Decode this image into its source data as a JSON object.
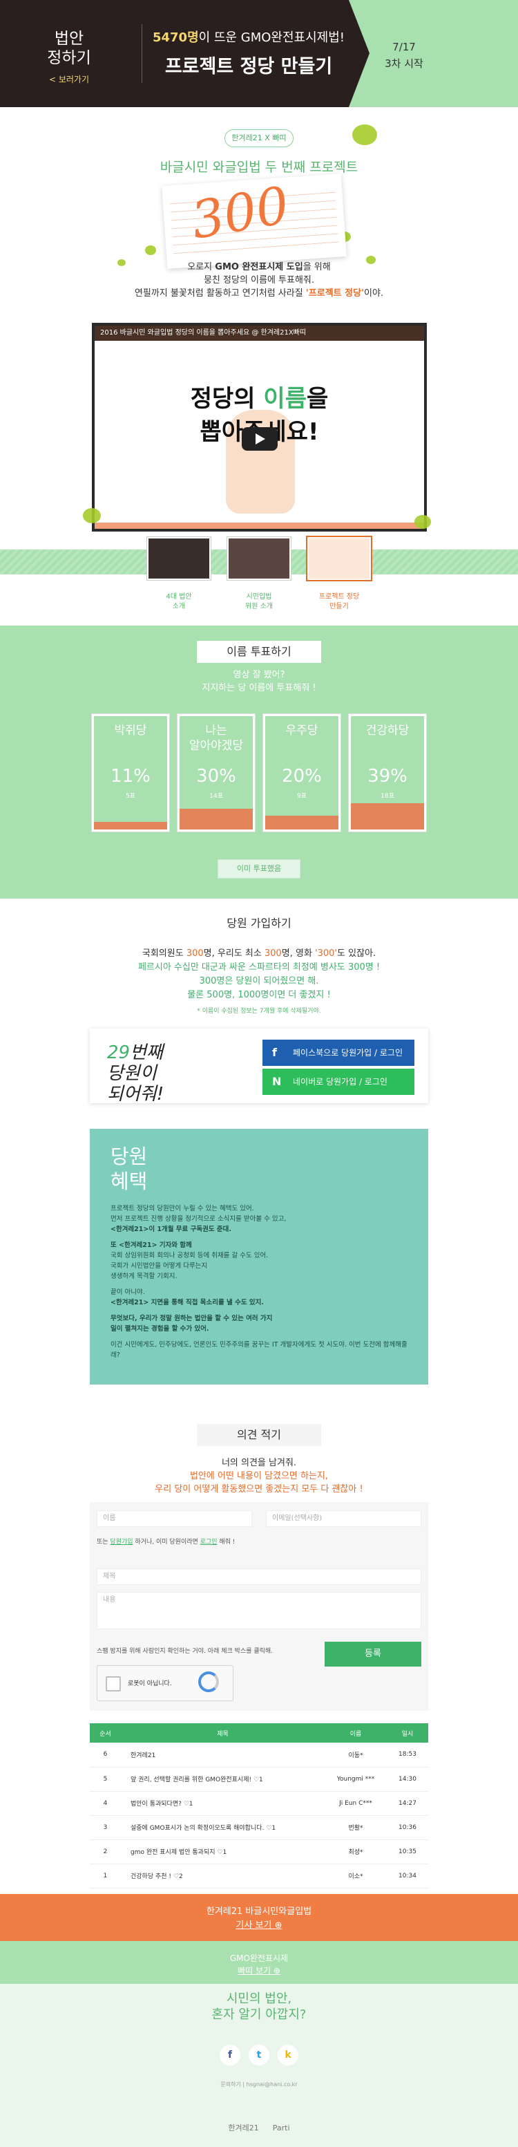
{
  "header": {
    "tab1": "법안",
    "tab2": "정하기",
    "back": "< 보러가기",
    "sub_pre": "5470명",
    "sub_post": "이 뜨운 GMO완전표시제법!",
    "title": "프로젝트 정당 만들기",
    "date": "7/17",
    "start": "3차 시작"
  },
  "hero": {
    "tag": "한겨레21 X 빠띠",
    "headline": "바글시민 와글입법 두 번째 프로젝트",
    "number": "300",
    "intro1_pre": "오로지 ",
    "intro1_hl": "GMO 완전표시제 도입",
    "intro1_post": "을 위해",
    "intro2": "뭉친 정당의 이름에 투표해줘.",
    "intro3_pre": "연필까지 불꽃처럼 활동하고 연기처럼 사라질 ",
    "intro3_hl": "'프로젝트 정당'",
    "intro3_post": "이야.",
    "video_title": "2016 바글시민 와글입법 정당의 이름을 뽑아주세요 @ 한겨레21X빠띠",
    "video_l1_pre": "정당의 ",
    "video_l1_hl": "이름",
    "video_l1_post": "을",
    "video_l2": "뽑아주세요!"
  },
  "thumbs": [
    {
      "label1": "4대 법안",
      "label2": "소개"
    },
    {
      "label1": "시민입법",
      "label2": "위원 소개"
    },
    {
      "label1": "프로젝트 정당",
      "label2": "만들기"
    }
  ],
  "vote": {
    "title": "이름 투표하기",
    "q1": "영상 잘 봤어?",
    "q2": "지지하는 당 이름에 투표해줘 !",
    "vote_button": "이미 투표했음",
    "cards": [
      {
        "name1": "박쥐당",
        "name2": "",
        "percent": "11%",
        "count": "5표",
        "ratio": 0.11
      },
      {
        "name1": "나는",
        "name2": "알아야겠당",
        "percent": "30%",
        "count": "14표",
        "ratio": 0.3
      },
      {
        "name1": "우주당",
        "name2": "",
        "percent": "20%",
        "count": "9표",
        "ratio": 0.2
      },
      {
        "name1": "건강하당",
        "name2": "",
        "percent": "39%",
        "count": "18표",
        "ratio": 0.39
      }
    ]
  },
  "join": {
    "title": "당원 가입하기",
    "d1_a": "국회의원도 ",
    "d1_b": "300",
    "d1_c": "명, 우리도 최소 ",
    "d1_d": "300",
    "d1_e": "명, 영화 ",
    "d1_f": "'300'",
    "d1_g": "도 있잖아.",
    "d2": "페르시아 수십만 대군과 싸운 스파르타의 최정예 병사도 300명 !",
    "d3": "300명은 당원이 되어줬으면 해.",
    "d4": "물론 500명, 1000명이면 더 좋겠지 !",
    "note": "* 이름이 수집된 정보는 7개월 후에 삭제될거야.",
    "num": "29",
    "box_t1": "번째",
    "box_t2": "당원이",
    "box_t3": "되어줘!",
    "fb_icon": "f",
    "fb": "페이스북으로 당원가입 / 로그인",
    "nv_icon": "N",
    "nv": "네이버로 당원가입 / 로그인",
    "ben_t1": "당원",
    "ben_t2": "혜택",
    "ben_lines": [
      "프로젝트 정당의 당원만이 누릴 수 있는 혜택도 있어.",
      "먼저 프로젝트 진행 상황을 정기적으로 소식지를 받아볼 수 있고,",
      "<한겨레21>이 1개월 무료 구독권도 준대.",
      "",
      "또 <한겨레21> 기자와 함께",
      "국회 상임위원회 회의나 공청회 등에 취재를 갈 수도 있어.",
      "국회가 시민법안을 어떻게 다루는지",
      "생생하게 목격할 기회지.",
      "",
      "끝이 아니야.",
      "<한겨레21> 지면을 통해 직접 목소리를 낼 수도 있지.",
      "",
      "무엇보다, 우리가 정말 원하는 법안을 할 수 있는 여러 가지",
      "일이 펼쳐지는 경험을 할 수가 있어.",
      "",
      "이건 시민에게도, 민주당에도, 언론인도 민주주의를 꿈꾸는 IT 개발자에게도 첫 시도야. 이번 도전에 함께해줄래?"
    ]
  },
  "comment": {
    "title": "의견 적기",
    "i1": "너의 의견을 남겨줘.",
    "i2": "법안에 어떤 내용이 담겼으면 하는지,",
    "i3": "우리 당이 어떻게 활동했으면 좋겠는지 모두 다 괜찮아 !",
    "name_ph": "이름",
    "email_ph": "이메일(선택사항)",
    "login_pre": "또는 ",
    "login_a": "당원가입",
    "login_mid": " 하거나, 이미 당원이라면 ",
    "login_b": "로그인",
    "login_post": " 해줘 !",
    "subject_ph": "제목",
    "body_ph": "내용",
    "spam": "스팸 방지를 위해 사람인지 확인하는 거야. 아래 체크 박스를 클릭해.",
    "captcha": "로봇이 아닙니다.",
    "submit": "등록",
    "cols": [
      "순서",
      "제목",
      "이름",
      "일시"
    ],
    "rows": [
      [
        "6",
        "한겨레21",
        "이동*",
        "18:53"
      ],
      [
        "5",
        "앞 권리, 선택할 권리를 위한 GMO완전표시제! ♡1",
        "Youngmi ***",
        "14:30"
      ],
      [
        "4",
        "법안이 통과되다면? ♡1",
        "Ji Eun C***",
        "14:27"
      ],
      [
        "3",
        "설중에 GMO표시가 논의 확정이오도록 해야합니다. ♡1",
        "번활*",
        "10:36"
      ],
      [
        "2",
        "gmo 완전 표시제 법안 통과되지 ♡1",
        "최성*",
        "10:35"
      ],
      [
        "1",
        "건강하당 추천 ! ♡2",
        "이소*",
        "10:34"
      ]
    ]
  },
  "bottom": {
    "orange1": "한겨레21 바글시민와글입법",
    "orange2": "기사 보기 ⊕",
    "green1": "GMO완전표시제",
    "green2": "빠띠 보기 ⊕",
    "q1": "시민의 법안,",
    "q2": "혼자 알기 아깝지?",
    "mail": "문의하기 | hsgnai@hani.co.kr",
    "logo1": "한겨레21",
    "logo2": "Parti"
  },
  "colors": {
    "green": "#3fb26a",
    "mint": "#a8e0b0",
    "orange": "#e56d2b",
    "dark": "#2a1f1f",
    "teal": "#7fcdbd"
  }
}
